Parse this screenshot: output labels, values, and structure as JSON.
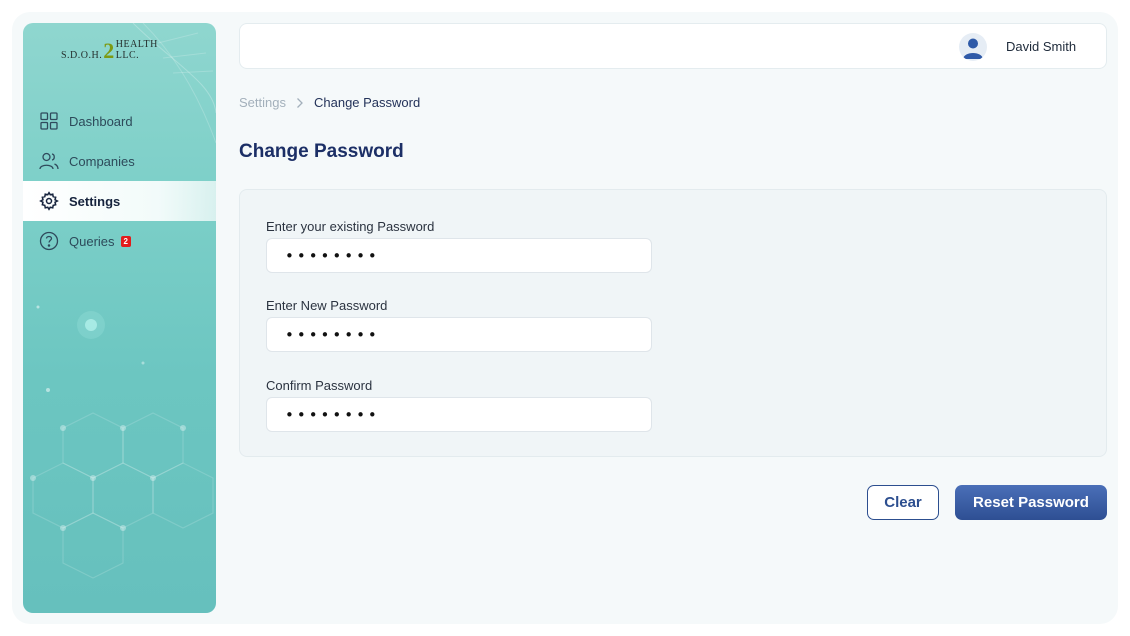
{
  "brand": {
    "logo_prefix": "S.D.O.H.",
    "logo_number": "2",
    "logo_suffix": "HEALTH LLC."
  },
  "sidebar": {
    "items": [
      {
        "label": "Dashboard",
        "icon": "dashboard-grid-icon",
        "active": false
      },
      {
        "label": "Companies",
        "icon": "users-icon",
        "active": false
      },
      {
        "label": "Settings",
        "icon": "gear-icon",
        "active": true
      },
      {
        "label": "Queries",
        "icon": "help-circle-icon",
        "active": false,
        "badge": "2"
      }
    ]
  },
  "header": {
    "user_name": "David Smith",
    "avatar_icon": "user-avatar-icon"
  },
  "breadcrumb": {
    "parent": "Settings",
    "current": "Change Password"
  },
  "page": {
    "title": "Change Password"
  },
  "form": {
    "existing_label": "Enter your existing Password",
    "existing_value": "••••••••",
    "new_label": "Enter New Password",
    "new_value": "••••••••",
    "confirm_label": "Confirm Password",
    "confirm_value": "••••••••"
  },
  "actions": {
    "clear_label": "Clear",
    "reset_label": "Reset Password"
  },
  "colors": {
    "sidebar_teal": "#6cc6c1",
    "primary_navy": "#2c4e8f",
    "title_navy": "#1c2f66",
    "badge_red": "#e21b1b"
  }
}
